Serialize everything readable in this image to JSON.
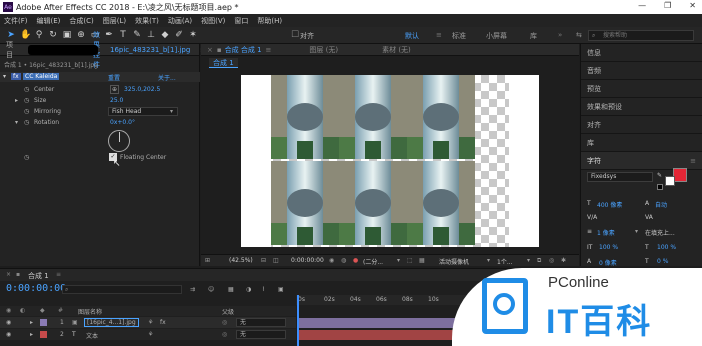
{
  "window": {
    "title": "Adobe After Effects CC 2018 - E:\\凌之风\\无标题项目.aep *",
    "app_icon_text": "Ae",
    "min": "—",
    "max": "❐",
    "close": "✕"
  },
  "menu": [
    "文件(F)",
    "编辑(E)",
    "合成(C)",
    "图层(L)",
    "效果(T)",
    "动画(A)",
    "视图(V)",
    "窗口",
    "帮助(H)"
  ],
  "toolbar": {
    "align_label": "对齐",
    "workspaces": [
      "默认",
      "标准",
      "小屏幕",
      "库"
    ],
    "search_placeholder": "搜索帮助"
  },
  "left_panel": {
    "tabs": [
      "项目",
      "效果控件",
      "16pic_483231_b[1].jpg"
    ],
    "breadcrumb": "合成 1 • 16pic_483231_b[1].jpg",
    "effect_name": "CC Kaleida",
    "reset": "重置",
    "about": "关于...",
    "props": [
      {
        "label": "Center",
        "value": "325.0,202.5"
      },
      {
        "label": "Size",
        "value": "25.0"
      },
      {
        "label": "Mirroring",
        "value": "Fish Head"
      },
      {
        "label": "Rotation",
        "value": "0x+0.0°"
      },
      {
        "label": "Floating Center",
        "value": ""
      }
    ]
  },
  "comp_panel": {
    "tabs": [
      "合成 合成 1",
      "图层 (无)",
      "素材 (无)"
    ],
    "subtab": "合成 1",
    "footer": {
      "zoom": "(42.5%)",
      "timecode": "0:00:00:00",
      "resolution": "(二分...",
      "camera": "活动摄像机",
      "views": "1个..."
    }
  },
  "right_panel": {
    "items": [
      "信息",
      "音频",
      "预览",
      "效果和预设",
      "对齐",
      "库",
      "字符"
    ],
    "font": "Fixedsys",
    "size": "400 像素",
    "leading": "自动",
    "indent_label": "1 像素",
    "stroke_mode": "在填充上...",
    "scale_v": "100 %",
    "scale_h": "100 %",
    "baseline": "0 像素",
    "tsume": "0 %",
    "fill_color": "#e32636"
  },
  "timeline": {
    "tab": "合成 1",
    "timecode": "0:00:00:00",
    "search_placeholder": "",
    "col_name": "图层名称",
    "col_parent": "父级",
    "ruler": [
      "0s",
      "02s",
      "04s",
      "06s",
      "08s",
      "10s"
    ],
    "layers": [
      {
        "num": "1",
        "name": "[16pic_4...1].jpg",
        "parent": "无",
        "color": "#8a7bb5"
      },
      {
        "num": "2",
        "name": "文本",
        "parent": "无",
        "color": "#c74b4b"
      }
    ]
  },
  "watermark": {
    "brand": "PConline",
    "title": "IT百科"
  }
}
